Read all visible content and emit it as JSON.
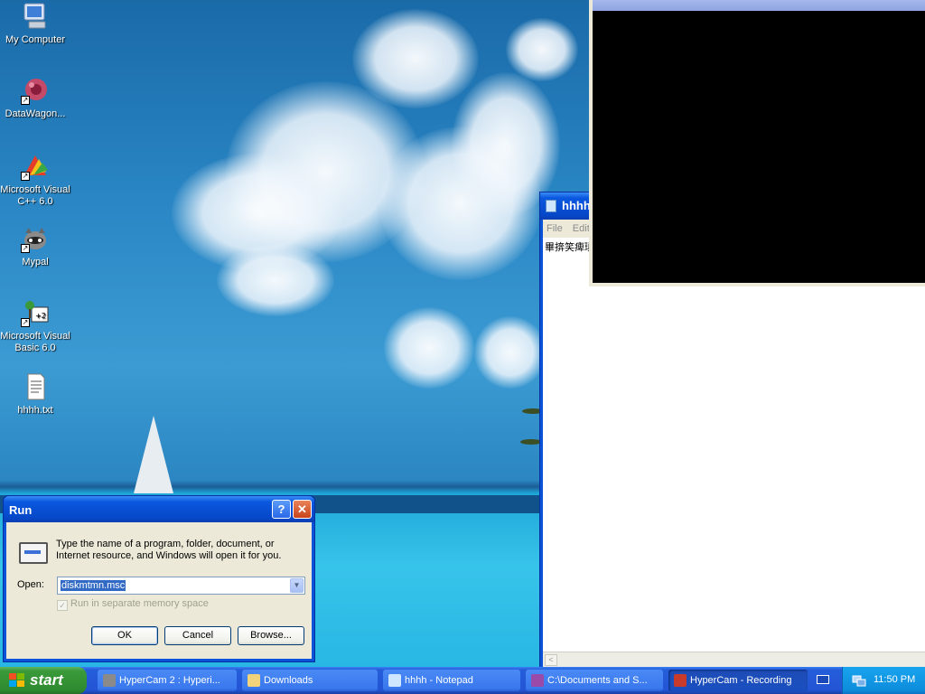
{
  "desktop": {
    "icons": [
      {
        "label": "My Computer"
      },
      {
        "label": "DataWagon..."
      },
      {
        "label": "Microsoft Visual C++ 6.0"
      },
      {
        "label": "Mypal"
      },
      {
        "label": "Microsoft Visual Basic 6.0"
      },
      {
        "label": "hhhh.txt"
      }
    ]
  },
  "notepad": {
    "title": "hhhh",
    "menu": [
      "File",
      "Edit"
    ],
    "content": "畢捹笑痺璘"
  },
  "run_dialog": {
    "title": "Run",
    "help_label": "?",
    "close_label": "✕",
    "description": "Type the name of a program, folder, document, or Internet resource, and Windows will open it for you.",
    "open_label": "Open:",
    "open_value": "diskmtmn.msc",
    "separate_memory_label": "Run in separate memory space",
    "buttons": {
      "ok": "OK",
      "cancel": "Cancel",
      "browse": "Browse..."
    }
  },
  "taskbar": {
    "start_label": "start",
    "tasks": [
      {
        "label": "HyperCam 2 : Hyperi...",
        "icon": "hypercam-icon"
      },
      {
        "label": "Downloads",
        "icon": "folder-icon"
      },
      {
        "label": "hhhh - Notepad",
        "icon": "notepad-icon"
      },
      {
        "label": "C:\\Documents and S...",
        "icon": "console-icon"
      },
      {
        "label": "HyperCam - Recording",
        "icon": "hypercam-record-icon"
      }
    ],
    "clock": "11:50 PM"
  },
  "colors": {
    "xp_blue": "#0a52d8",
    "start_green": "#3a9a3a",
    "tray_blue": "#0d8ddc",
    "dialog_bg": "#ece9d8"
  }
}
